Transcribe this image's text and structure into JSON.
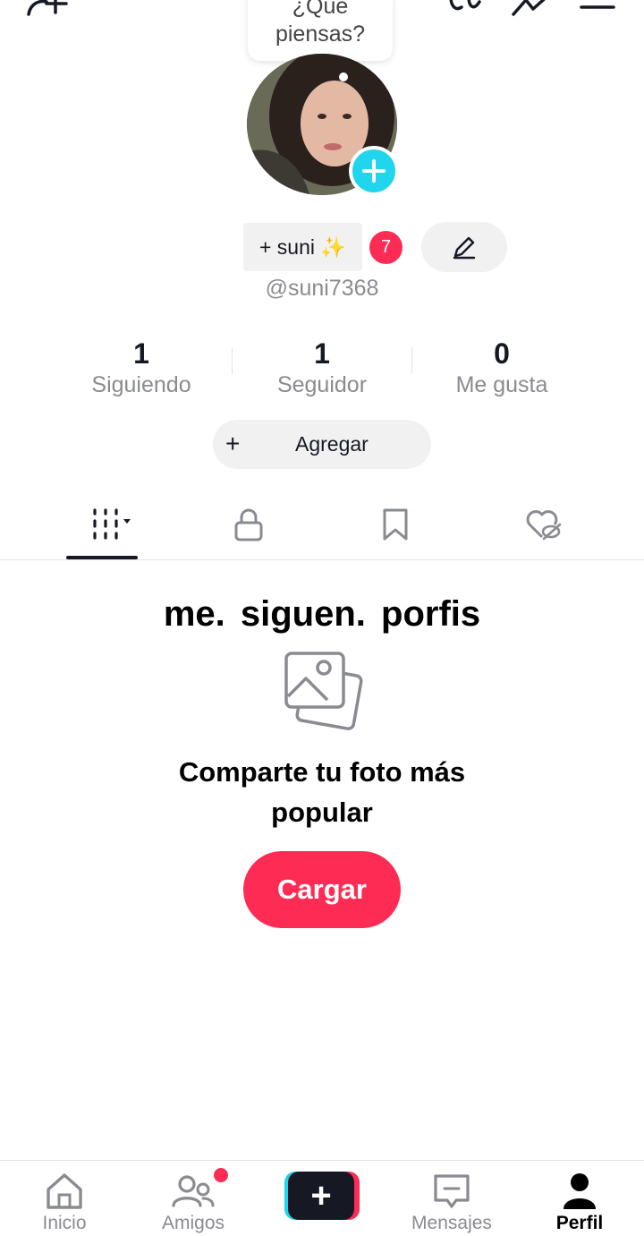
{
  "top_bar": {
    "add_friend_icon": "person-add-icon",
    "glasses_icon": "glasses-icon",
    "trending_icon": "trending-up-icon",
    "menu_icon": "menu-icon"
  },
  "bubble": {
    "line1": "¿Qué",
    "line2": "piensas?"
  },
  "profile": {
    "name_label": "+ suni ✨",
    "notification_count": "7",
    "handle": "@suni7368"
  },
  "stats": [
    {
      "value": "1",
      "label": "Siguiendo"
    },
    {
      "value": "1",
      "label": "Seguidor"
    },
    {
      "value": "0",
      "label": "Me gusta"
    }
  ],
  "add_bio": {
    "plus": "+",
    "label": "Agregar"
  },
  "tabs": [
    "grid-icon",
    "lock-icon",
    "bookmark-icon",
    "liked-heart-icon"
  ],
  "bio_text": "me.  siguen.  porfis",
  "empty_state": {
    "icon": "photos-icon",
    "title": "Comparte tu foto más popular",
    "button": "Cargar"
  },
  "bottom_nav": {
    "home": "Inicio",
    "friends": "Amigos",
    "create": "+",
    "messages": "Mensajes",
    "profile": "Perfil"
  },
  "colors": {
    "accent": "#fe2c55",
    "cyan": "#20d5ec",
    "text": "#161823",
    "secondary_text": "#8a8b91",
    "chip_bg": "#f1f1f2"
  }
}
